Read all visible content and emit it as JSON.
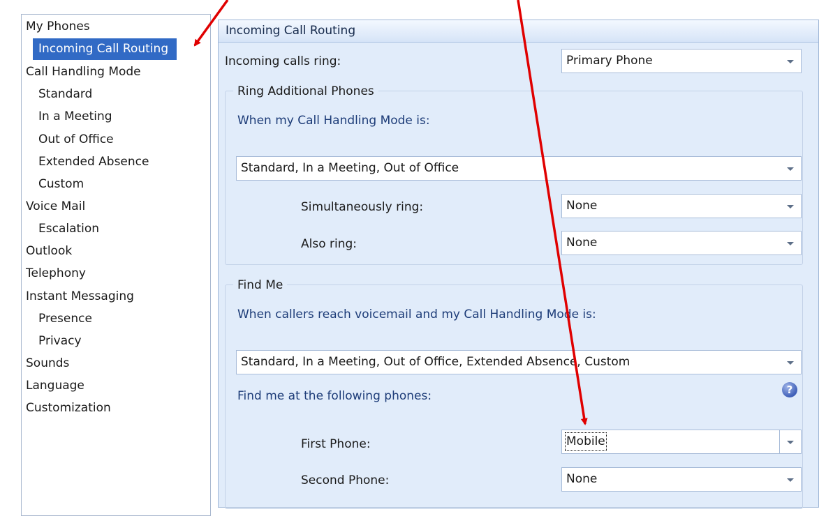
{
  "sidebar": {
    "items": [
      {
        "label": "My Phones"
      },
      {
        "label": "Incoming Call Routing"
      },
      {
        "label": "Call Handling Mode"
      },
      {
        "label": "Standard"
      },
      {
        "label": "In a Meeting"
      },
      {
        "label": "Out of Office"
      },
      {
        "label": "Extended Absence"
      },
      {
        "label": "Custom"
      },
      {
        "label": "Voice Mail"
      },
      {
        "label": "Escalation"
      },
      {
        "label": "Outlook"
      },
      {
        "label": "Telephony"
      },
      {
        "label": "Instant Messaging"
      },
      {
        "label": "Presence"
      },
      {
        "label": "Privacy"
      },
      {
        "label": "Sounds"
      },
      {
        "label": "Language"
      },
      {
        "label": "Customization"
      }
    ]
  },
  "panel": {
    "title": "Incoming Call Routing",
    "incoming_label": "Incoming calls ring:",
    "incoming_value": "Primary Phone",
    "ring_group": {
      "title": "Ring Additional Phones",
      "mode_label": "When my Call Handling Mode is:",
      "mode_value": "Standard, In a Meeting, Out of Office",
      "simul_label": "Simultaneously ring:",
      "simul_value": "None",
      "also_label": "Also ring:",
      "also_value": "None"
    },
    "findme_group": {
      "title": "Find Me",
      "mode_label": "When callers reach voicemail and my Call Handling Mode is:",
      "mode_value": "Standard, In a Meeting, Out of Office, Extended Absence, Custom",
      "phones_label": "Find me at the following phones:",
      "first_label": "First Phone:",
      "first_value": "Mobile",
      "second_label": "Second Phone:",
      "second_value": "None"
    }
  },
  "colors": {
    "selection": "#316ac5",
    "annotation_arrow": "#e00000",
    "panel_background": "#e1ecfa"
  }
}
